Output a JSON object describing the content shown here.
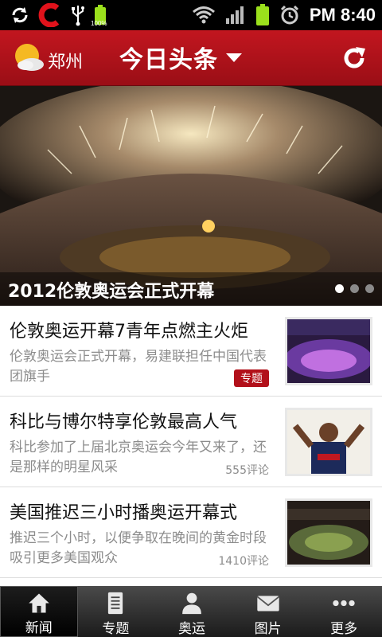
{
  "status_bar": {
    "battery_small_text": "100%",
    "time": "PM 8:40",
    "icons": [
      "sync-icon",
      "app-c-icon",
      "usb-icon",
      "battery-icon",
      "wifi-icon",
      "signal-icon",
      "battery-icon",
      "alarm-icon"
    ]
  },
  "header": {
    "city": "郑州",
    "title": "今日头条",
    "accent": "#c2161f"
  },
  "banner": {
    "title": "2012伦敦奥运会正式开幕",
    "pages": 3,
    "active_page": 1
  },
  "news": [
    {
      "title": "伦敦奥运开幕7青年点燃主火炬",
      "desc": "伦敦奥运会正式开幕，易建联担任中国代表团旗手",
      "tag": "专题",
      "meta": ""
    },
    {
      "title": "科比与博尔特享伦敦最高人气",
      "desc": "科比参加了上届北京奥运会今年又来了，还是那样的明星风采",
      "tag": "",
      "meta": "555评论"
    },
    {
      "title": "美国推迟三小时播奥运开幕式",
      "desc": "推迟三个小时，以便争取在晚间的黄金时段吸引更多美国观众",
      "tag": "",
      "meta": "1410评论"
    }
  ],
  "bottom_nav": [
    {
      "label": "新闻",
      "icon": "home-icon",
      "active": true
    },
    {
      "label": "专题",
      "icon": "document-icon",
      "active": false
    },
    {
      "label": "奥运",
      "icon": "person-icon",
      "active": false
    },
    {
      "label": "图片",
      "icon": "mail-icon",
      "active": false
    },
    {
      "label": "更多",
      "icon": "more-icon",
      "active": false
    }
  ]
}
